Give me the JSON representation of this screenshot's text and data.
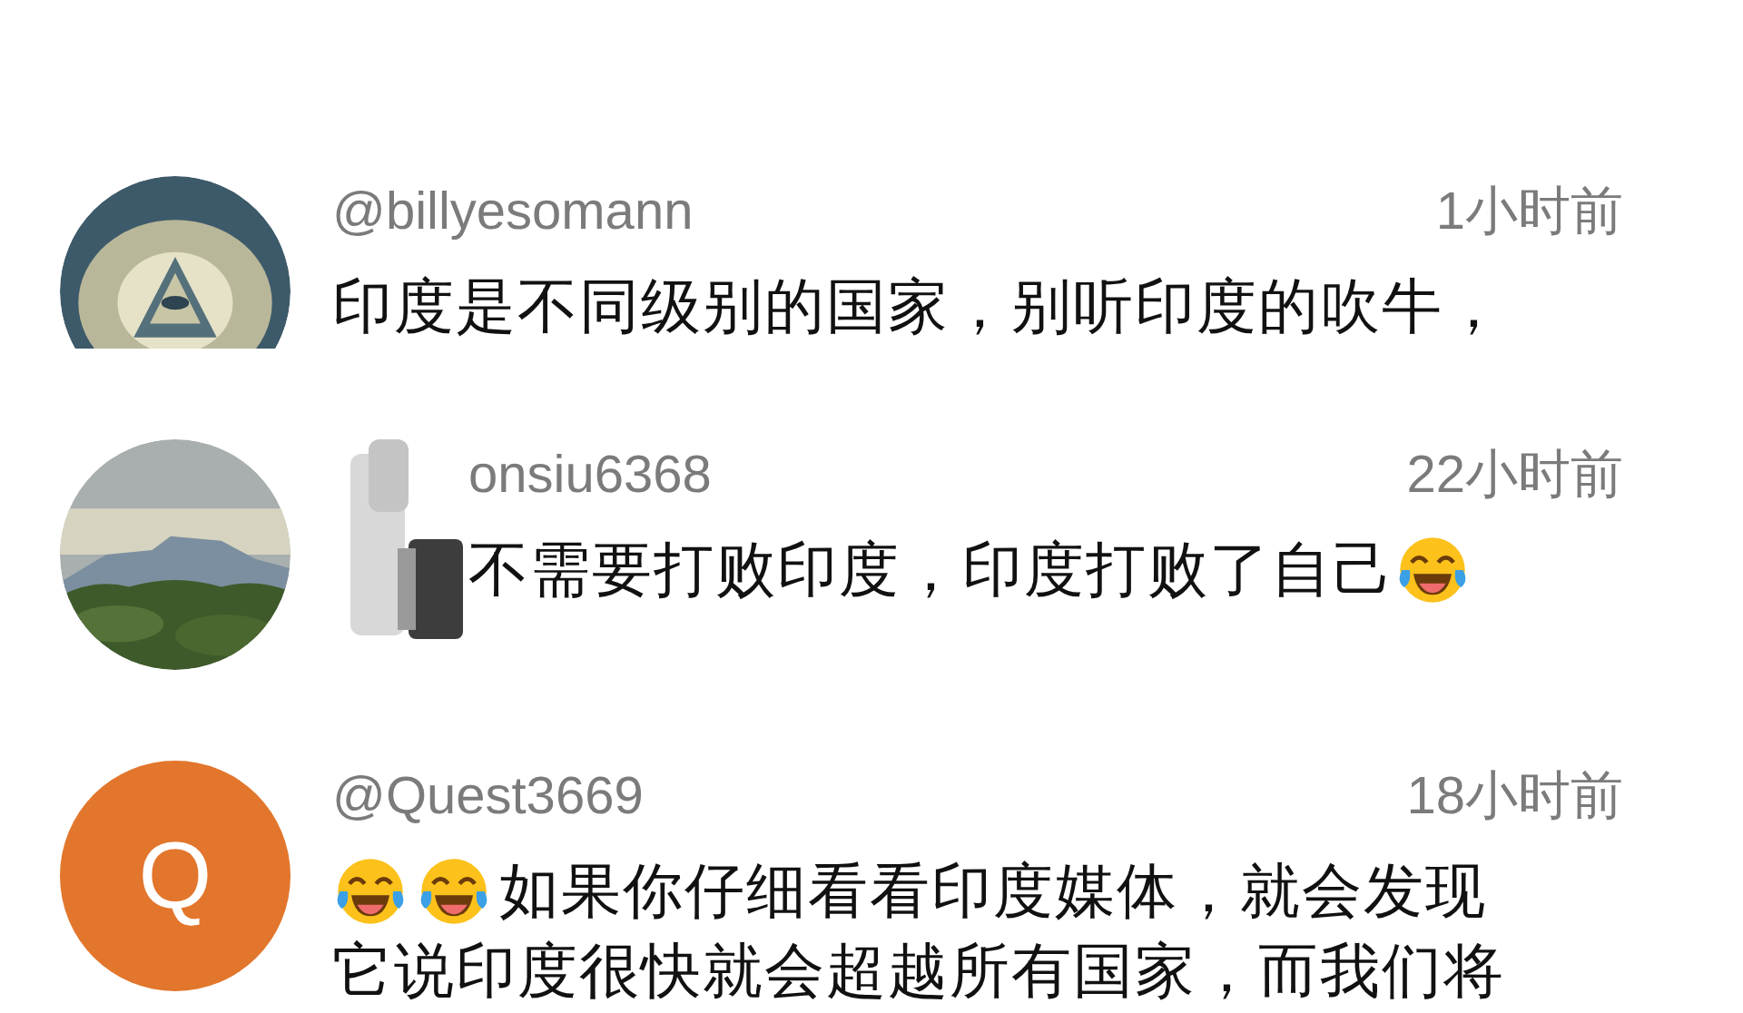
{
  "comments": [
    {
      "avatar": {
        "kind": "picture"
      },
      "username": "@billyesomann",
      "time": "1小时前",
      "redacted": false,
      "lines": [
        [
          {
            "kind": "text",
            "text": "印度是不同级别的国家，别听印度的吹牛，"
          }
        ]
      ]
    },
    {
      "avatar": {
        "kind": "picture"
      },
      "username": "onsiu6368",
      "time": "22小时前",
      "redacted": true,
      "lines": [
        [
          {
            "kind": "text",
            "text": "不需要打败印度，印度打败了自己"
          },
          {
            "kind": "emoji"
          }
        ]
      ]
    },
    {
      "avatar": {
        "kind": "letter",
        "letter": "Q",
        "color": "#e2762c"
      },
      "username": "@Quest3669",
      "time": "18小时前",
      "redacted": false,
      "lines": [
        [
          {
            "kind": "emoji"
          },
          {
            "kind": "emoji"
          },
          {
            "kind": "text",
            "text": "如果你仔细看看印度媒体，就会发现"
          }
        ],
        [
          {
            "kind": "text",
            "text": "它说印度很快就会超越所有国家，而我们将"
          }
        ]
      ]
    }
  ]
}
